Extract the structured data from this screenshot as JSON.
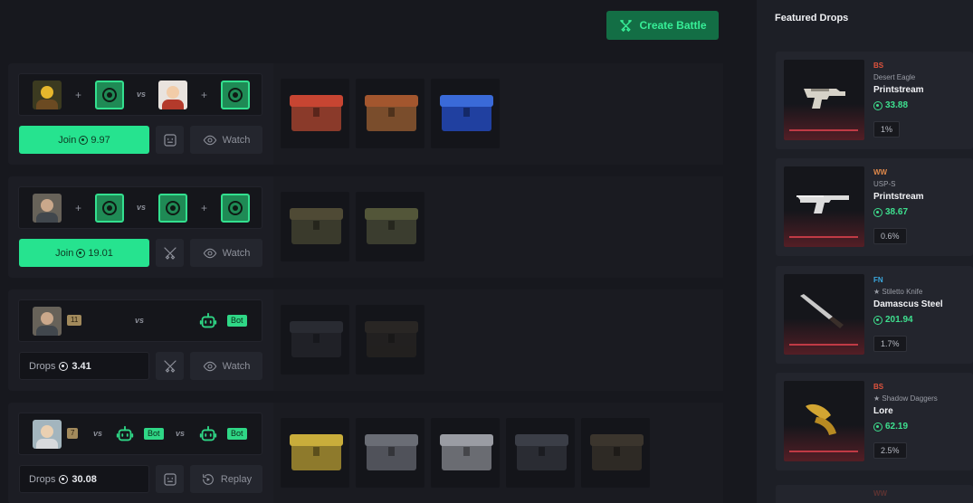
{
  "header": {
    "create_label": "Create Battle"
  },
  "battles": [
    {
      "sep1": "+",
      "vs": "vs",
      "sep2": "+",
      "action": "Join",
      "price": "9.97",
      "secondary": "Watch"
    },
    {
      "sep1": "+",
      "vs": "vs",
      "sep2": "+",
      "action": "Join",
      "price": "19.01",
      "secondary": "Watch"
    },
    {
      "level": "11",
      "vs": "vs",
      "bot": "Bot",
      "drops_label": "Drops",
      "drops_value": "3.41",
      "secondary": "Watch"
    },
    {
      "level": "7",
      "vs1": "vs",
      "bot1": "Bot",
      "vs2": "vs",
      "bot2": "Bot",
      "drops_label": "Drops",
      "drops_value": "30.08",
      "secondary": "Replay"
    }
  ],
  "sidebar": {
    "title": "Featured Drops",
    "drops": [
      {
        "condition": "BS",
        "weapon": "Desert Eagle",
        "name": "Printstream",
        "price": "33.88",
        "chance": "1%"
      },
      {
        "condition": "WW",
        "weapon": "USP-S",
        "name": "Printstream",
        "price": "38.67",
        "chance": "0.6%"
      },
      {
        "condition": "FN",
        "weapon": "★ Stiletto Knife",
        "name": "Damascus Steel",
        "price": "201.94",
        "chance": "1.7%"
      },
      {
        "condition": "BS",
        "weapon": "★ Shadow Daggers",
        "name": "Lore",
        "price": "62.19",
        "chance": "2.5%"
      }
    ],
    "partial_condition": "WW"
  },
  "colors": {
    "accent": "#26e38f",
    "bs": "#e0533d",
    "ww": "#e0894a",
    "fn": "#3aa9e0"
  }
}
